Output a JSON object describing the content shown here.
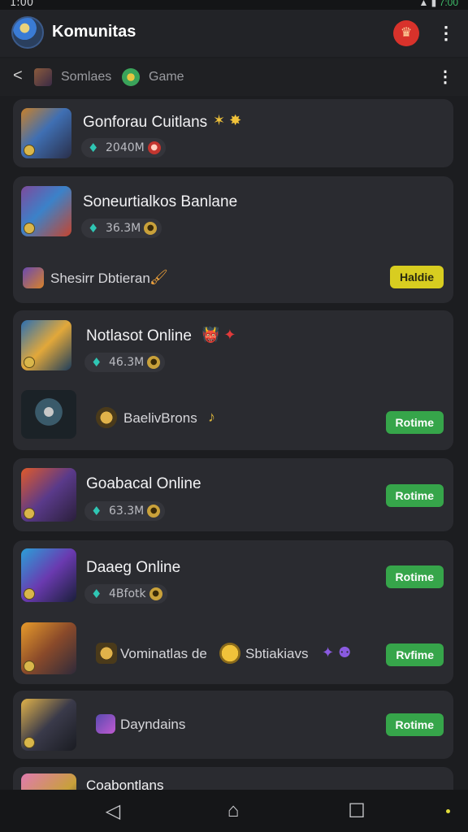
{
  "status": {
    "time": "1:00",
    "signal": "▲ ▮",
    "battery": "7:00"
  },
  "appbar": {
    "title": "Komunitas",
    "notif_glyph": "♛",
    "menu_glyph": "⋮"
  },
  "subbar": {
    "back_glyph": "<",
    "crumbs": [
      "Somlaes",
      "Game"
    ],
    "menu_glyph": "⋮"
  },
  "cards": [
    {
      "title": "Gonforau Cuitlans",
      "deco": "✶ ✸",
      "stat": "2040M"
    },
    {
      "title": "Soneurtialkos Banlane",
      "stat": "36.3M",
      "sub_text": "Shesirr Dbtieran.",
      "sub_deco": "🖌",
      "button": "Haldie"
    },
    {
      "title": "Notlasot Online",
      "deco": "👹 ✦",
      "stat": "46.3M",
      "sub_text": "BaelivBrons",
      "sub_deco": "♪",
      "button": "Rotime"
    },
    {
      "title": "Goabacal Online",
      "stat": "63.3M",
      "button": "Rotime"
    },
    {
      "title": "Daaeg Online",
      "stat": "4Bfotk",
      "sub_text": "Vominatlas de",
      "sub_text2": "Sbtiakiavs",
      "sub_deco": "✦ ⚉",
      "button": "Rotime",
      "button2": "Rvfime"
    },
    {
      "title": "Dayndains",
      "button": "Rotime"
    },
    {
      "title": "Coabontlans"
    }
  ],
  "navbar": {
    "back": "◁",
    "home": "⌂",
    "recent": "☐"
  }
}
